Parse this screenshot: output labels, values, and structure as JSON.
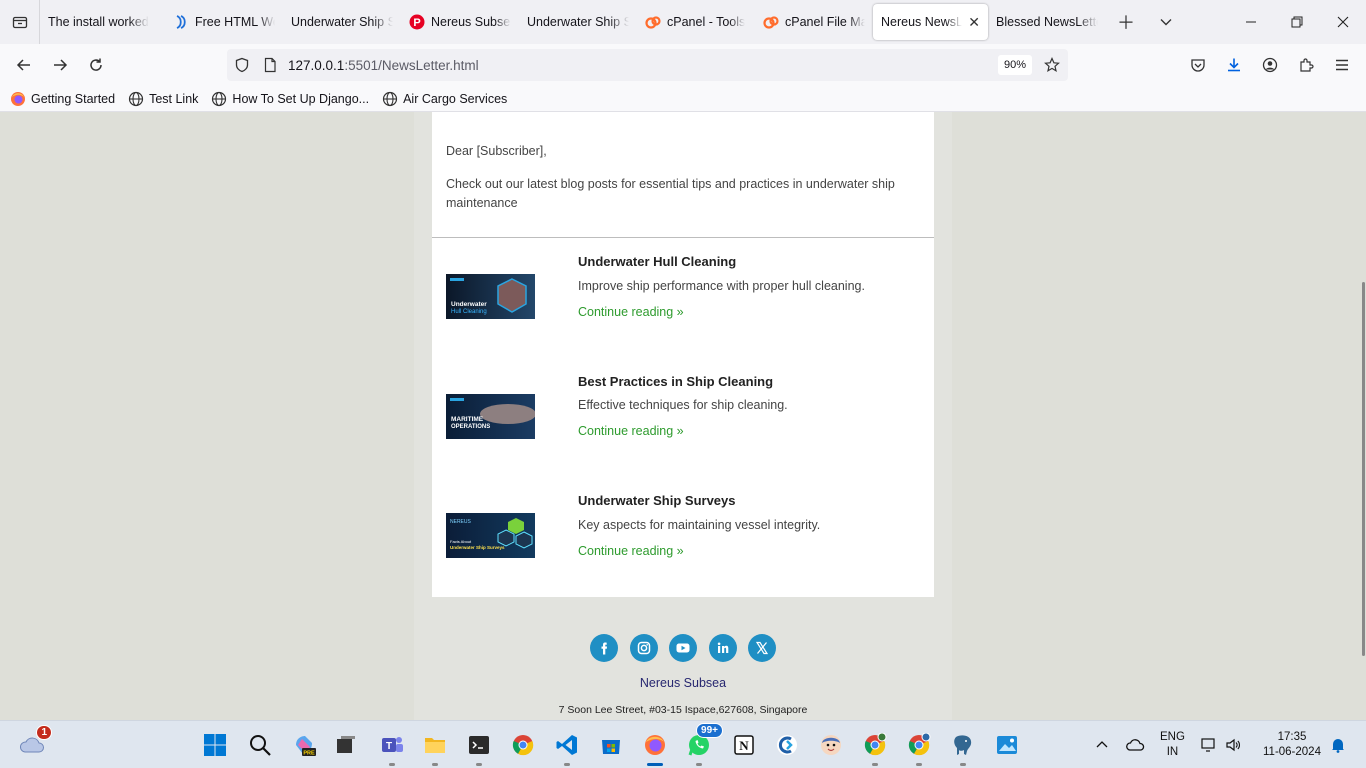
{
  "browser": {
    "tabs": [
      {
        "label": "The install worked",
        "icon": "none",
        "active": false
      },
      {
        "label": "Free HTML We",
        "icon": "wave-icon",
        "active": false
      },
      {
        "label": "Underwater Ship S",
        "icon": "none",
        "active": false
      },
      {
        "label": "Nereus Subsea",
        "icon": "pinterest-icon",
        "active": false
      },
      {
        "label": "Underwater Ship S",
        "icon": "none",
        "active": false
      },
      {
        "label": "cPanel - Tools",
        "icon": "cpanel-icon",
        "active": false
      },
      {
        "label": "cPanel File Ma",
        "icon": "cpanel-icon",
        "active": false
      },
      {
        "label": "Nereus NewsLe",
        "icon": "none",
        "active": true
      },
      {
        "label": "Blessed NewsLette",
        "icon": "none",
        "active": false
      }
    ],
    "url": {
      "host": "127.0.0.1",
      "path": ":5501/NewsLetter.html"
    },
    "zoom": "90%",
    "bookmarks": [
      {
        "label": "Getting Started",
        "icon": "firefox-icon"
      },
      {
        "label": "Test Link",
        "icon": "globe-icon"
      },
      {
        "label": "How To Set Up Django...",
        "icon": "globe-icon"
      },
      {
        "label": "Air Cargo Services",
        "icon": "globe-icon"
      }
    ]
  },
  "newsletter": {
    "greeting": "Dear [Subscriber],",
    "intro": "Check out our latest blog posts for essential tips and practices in underwater ship maintenance",
    "posts": [
      {
        "title": "Underwater Hull Cleaning",
        "description": "Improve ship performance with proper hull cleaning.",
        "link": "Continue reading »",
        "thumb_text": "Underwater Hull Cleaning"
      },
      {
        "title": "Best Practices in Ship Cleaning",
        "description": "Effective techniques for ship cleaning.",
        "link": "Continue reading »",
        "thumb_text": "MARITIME OPERATIONS"
      },
      {
        "title": "Underwater Ship Surveys",
        "description": "Key aspects for maintaining vessel integrity.",
        "link": "Continue reading »",
        "thumb_text": "Underwater Ship Surveys"
      }
    ],
    "socials": [
      "facebook-icon",
      "instagram-icon",
      "youtube-icon",
      "linkedin-icon",
      "x-icon"
    ],
    "footer_name": "Nereus Subsea",
    "footer_address": "7 Soon Lee Street, #03-15 Ispace,627608, Singapore"
  },
  "taskbar": {
    "weather_badge": "1",
    "whatsapp_badge": "99+",
    "lang": "ENG",
    "region": "IN",
    "time": "17:35",
    "date": "11-06-2024"
  },
  "colors": {
    "link_green": "#2e9b2e",
    "social_blue": "#1f8fc4",
    "footer_navy": "#272770"
  }
}
